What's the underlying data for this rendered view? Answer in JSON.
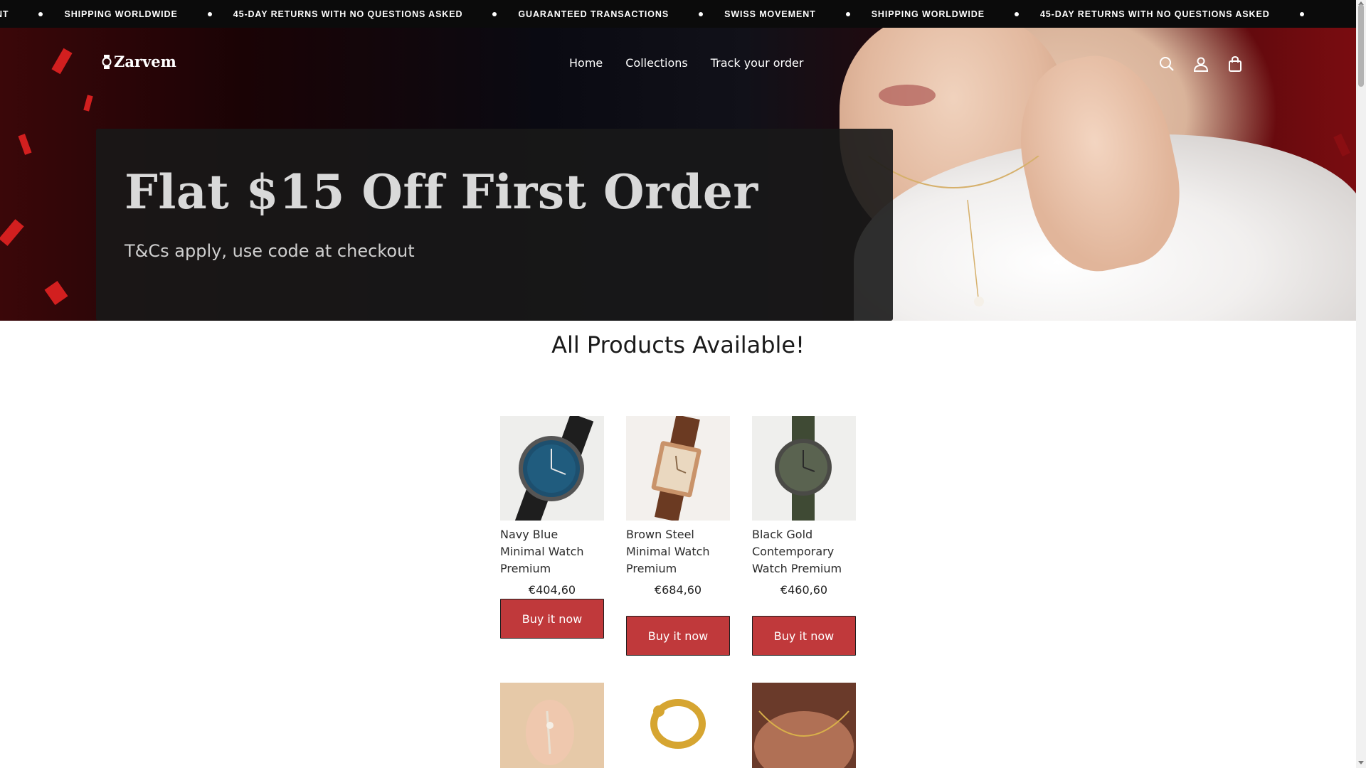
{
  "announcement": {
    "items": [
      "NT",
      "SHIPPING WORLDWIDE",
      "45-DAY RETURNS WITH NO QUESTIONS ASKED",
      "GUARANTEED TRANSACTIONS",
      "SWISS MOVEMENT",
      "SHIPPING WORLDWIDE",
      "45-DAY RETURNS WITH NO QUESTIONS ASKED"
    ]
  },
  "header": {
    "logo": "Zarvem",
    "nav": [
      "Home",
      "Collections",
      "Track your order"
    ],
    "icons": [
      "search-icon",
      "account-icon",
      "cart-icon"
    ]
  },
  "hero": {
    "title": "Flat $15 Off First Order",
    "subtitle": "T&Cs apply, use code at checkout"
  },
  "products_section": {
    "title": "All Products Available!",
    "products": [
      {
        "name": "Navy Blue Minimal Watch Premium",
        "price": "€404,60",
        "button": "Buy it now"
      },
      {
        "name": "Brown Steel Minimal Watch Premium",
        "price": "€684,60",
        "button": "Buy it now"
      },
      {
        "name": "Black Gold Contemporary Watch Premium",
        "price": "€460,60",
        "button": "Buy it now"
      }
    ]
  },
  "colors": {
    "announcement_bg": "#0b0b0b",
    "button_bg": "#c0393b",
    "text": "#1a1a1a"
  }
}
